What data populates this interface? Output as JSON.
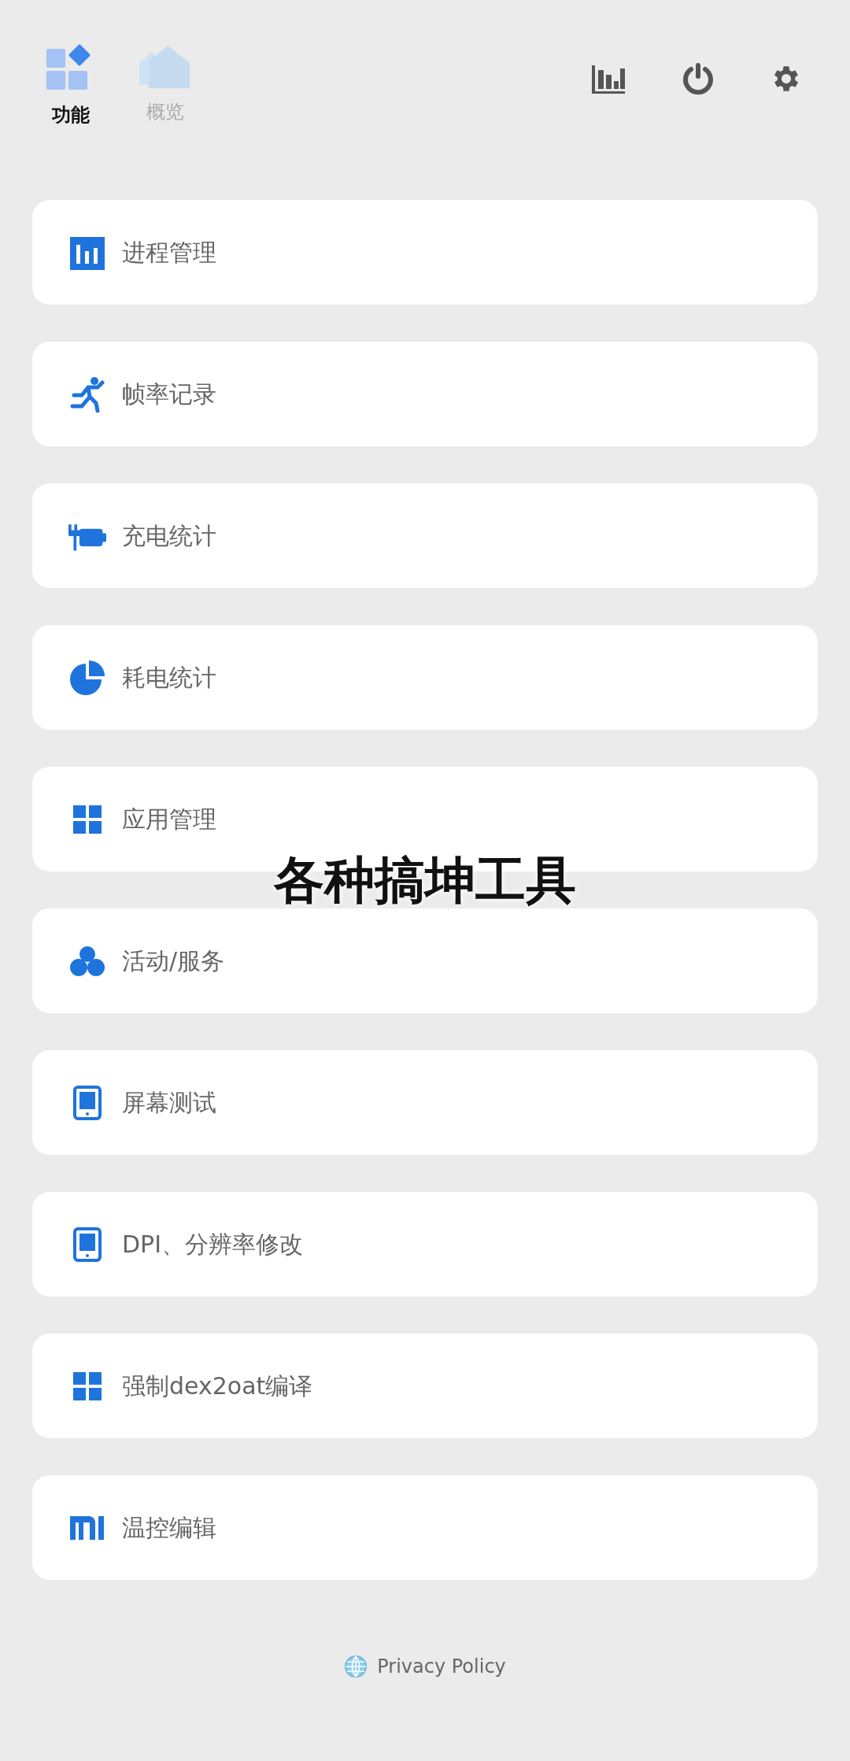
{
  "tabs": [
    {
      "label": "功能",
      "selected": true
    },
    {
      "label": "概览",
      "selected": false
    }
  ],
  "items": [
    {
      "kind": "bars",
      "label": "进程管理"
    },
    {
      "kind": "runner",
      "label": "帧率记录"
    },
    {
      "kind": "charger",
      "label": "充电统计"
    },
    {
      "kind": "pie",
      "label": "耗电统计"
    },
    {
      "kind": "grid",
      "label": "应用管理"
    },
    {
      "kind": "circles",
      "label": "活动/服务"
    },
    {
      "kind": "tablet",
      "label": "屏幕测试"
    },
    {
      "kind": "tablet",
      "label": "DPI、分辨率修改"
    },
    {
      "kind": "grid",
      "label": "强制dex2oat编译"
    },
    {
      "kind": "mi",
      "label": "温控编辑"
    }
  ],
  "footer_link": "Privacy Policy",
  "caption": "各种搞坤工具"
}
